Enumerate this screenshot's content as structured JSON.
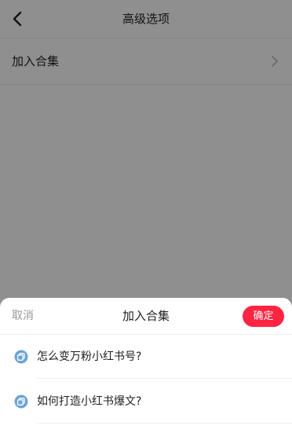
{
  "nav": {
    "title": "高级选项",
    "back_icon": "chevron-left-icon"
  },
  "options": [
    {
      "label": "加入合集",
      "icon": "chevron-right-icon"
    }
  ],
  "sheet": {
    "title": "加入合集",
    "cancel_label": "取消",
    "confirm_label": "确定",
    "items": [
      {
        "label": "怎么变万粉小红书号?",
        "icon": "collection-icon"
      },
      {
        "label": "如何打造小红书爆文?",
        "icon": "collection-icon"
      }
    ]
  },
  "colors": {
    "accent": "#ff2442",
    "icon_blue": "#6aa3d8",
    "overlay": "rgba(0,0,0,0.44)"
  }
}
